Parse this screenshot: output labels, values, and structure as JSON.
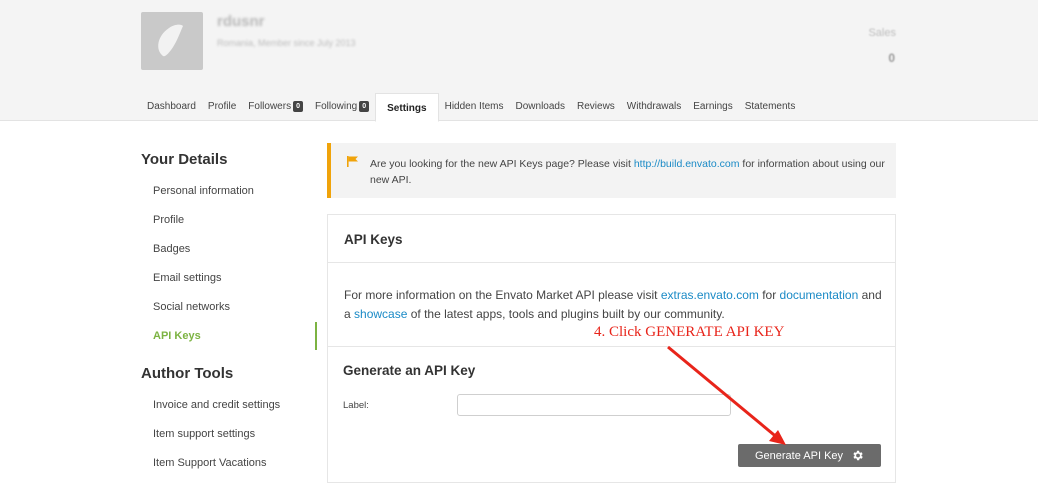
{
  "header": {
    "username": "rdusnr",
    "user_subtitle": "Romania, Member since July 2013",
    "sales_label": "Sales",
    "sales_value": "0"
  },
  "tabs": [
    {
      "label": "Dashboard"
    },
    {
      "label": "Profile"
    },
    {
      "label": "Followers",
      "count": "0"
    },
    {
      "label": "Following",
      "count": "0"
    },
    {
      "label": "Settings",
      "active": true
    },
    {
      "label": "Hidden Items"
    },
    {
      "label": "Downloads"
    },
    {
      "label": "Reviews"
    },
    {
      "label": "Withdrawals"
    },
    {
      "label": "Earnings"
    },
    {
      "label": "Statements"
    }
  ],
  "sidebar": {
    "your_details_title": "Your Details",
    "your_details_items": [
      "Personal information",
      "Profile",
      "Badges",
      "Email settings",
      "Social networks",
      "API Keys"
    ],
    "author_tools_title": "Author Tools",
    "author_tools_items": [
      "Invoice and credit settings",
      "Item support settings",
      "Item Support Vacations"
    ]
  },
  "notice": {
    "text_before": "Are you looking for the new API Keys page? Please visit ",
    "link": "http://build.envato.com",
    "text_after": " for information about using our new API."
  },
  "api_keys": {
    "title": "API Keys",
    "desc_1": "For more information on the Envato Market API please visit ",
    "link_extras": "extras.envato.com",
    "desc_2": " for ",
    "link_documentation": "documentation",
    "desc_3": " and a ",
    "link_showcase": "showcase",
    "desc_4": " of the latest apps, tools and plugins built by our community."
  },
  "annotation": "4. Click  GENERATE API KEY",
  "generate": {
    "title": "Generate an API Key",
    "label": "Label:",
    "input_value": "",
    "button_label": "Generate API Key"
  },
  "colors": {
    "accent_green": "#7cb342",
    "notice_orange": "#f0a30a",
    "link_blue": "#1a8ac6",
    "annotation_red": "#e8241a"
  }
}
